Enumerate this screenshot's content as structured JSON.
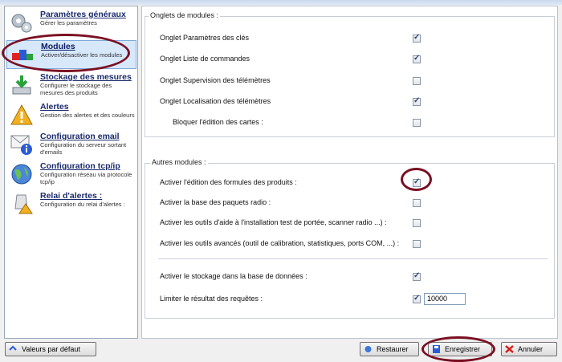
{
  "sidebar": {
    "items": [
      {
        "title": "Paramètres généraux",
        "desc": "Gérer les paramètres"
      },
      {
        "title": "Modules",
        "desc": "Activer/désactiver les modules"
      },
      {
        "title": "Stockage des mesures",
        "desc": "Configurer le stockage des mesures des produits"
      },
      {
        "title": "Alertes",
        "desc": "Gestion des alertes et des couleurs"
      },
      {
        "title": "Configuration email",
        "desc": "Configuration du serveur sortant d'emails"
      },
      {
        "title": "Configuration tcp/ip",
        "desc": "Configuration réseau via protocole tcp/ip"
      },
      {
        "title": "Relai d'alertes :",
        "desc": "Configuration du relai d'alertes :"
      }
    ]
  },
  "onglets": {
    "title": "Onglets de modules :",
    "rows": [
      {
        "label": "Onglet Paramètres des clés",
        "checked": true
      },
      {
        "label": "Onglet Liste de commandes",
        "checked": true
      },
      {
        "label": "Onglet Supervision des télémètres",
        "checked": false
      },
      {
        "label": "Onglet Localisation des télémètres",
        "checked": true
      },
      {
        "label": "Bloquer l'édition des cartes :",
        "checked": false
      }
    ]
  },
  "autres": {
    "title": "Autres modules :",
    "rows": [
      {
        "label": "Activer l'édition des formules des produits :",
        "checked": true
      },
      {
        "label": "Activer la base des paquets radio :",
        "checked": false
      },
      {
        "label": "Activer les outils d'aide à l'installation test de portée, scanner radio ...) :",
        "checked": false
      },
      {
        "label": "Activer les outils avancés (outil de calibration, statistiques, ports COM, ...) :",
        "checked": false
      },
      {
        "label": "Activer le stockage dans la base de données :",
        "checked": true
      },
      {
        "label": "Limiter le résultat des requêtes :",
        "checked": true
      }
    ],
    "limit_value": "10000"
  },
  "buttons": {
    "left": "Valeurs par défaut",
    "restore": "Restaurer",
    "save": "Enregistrer",
    "cancel": "Annuler"
  },
  "colors": {
    "annotation": "#7a0f22",
    "accent": "#1a2a6c"
  }
}
